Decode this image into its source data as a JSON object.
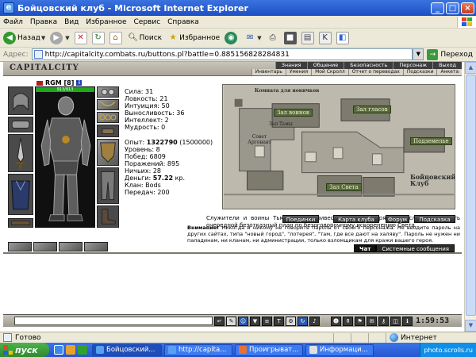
{
  "window": {
    "title": "Бойцовский клуб - Microsoft Internet Explorer",
    "buttons": [
      "_",
      "□",
      "×"
    ]
  },
  "menu": [
    "Файл",
    "Правка",
    "Вид",
    "Избранное",
    "Сервис",
    "Справка"
  ],
  "toolbar": {
    "back": "Назад",
    "search": "Поиск",
    "favorites": "Избранное"
  },
  "address": {
    "label": "Адрес:",
    "url": "http://capitalcity.combats.ru/buttons.pl?battle=0.885156828284831",
    "go": "Переход"
  },
  "site": {
    "logo": "CAPITALCITY",
    "nav_top": [
      "Знания",
      "Общение",
      "Безопасность",
      "Персонаж",
      "Выход"
    ],
    "nav_sub": [
      "Инвентарь",
      "Умения",
      "Мой Скролл",
      "Отчет о переводах",
      "Подсказки",
      "Анкета"
    ]
  },
  "character": {
    "name": "RGM",
    "level": "[8]",
    "hp": "913/913",
    "stats": [
      "Сила: 31",
      "Ловкость: 21",
      "Интуиция: 50",
      "Выносливость: 36",
      "Интеллект: 2",
      "Мудрость: 0"
    ],
    "experience_label": "Опыт:",
    "experience_value": "1322790",
    "experience_next": "(1500000)",
    "details": [
      "Уровень: 8",
      "Побед: 6809",
      "Поражений: 895",
      "Ничьих: 28"
    ],
    "money_label": "Деньги:",
    "money_value": "57.22",
    "money_unit": "кр.",
    "clan": "Клан: Bods",
    "transfers": "Передач: 200"
  },
  "map": {
    "labels": {
      "room1": "Комната для новичков",
      "room2": "Зал воинов",
      "room3": "Зал Тьмы",
      "room4": "Подземелье",
      "room5": "Совет Аргонавт",
      "room6": "Зал Света",
      "room7": "Зал гласов",
      "room8": "Бойцовский Клуб"
    },
    "description": "Служители и воины Тьмы могут привести здесь в порядок мысли и составить очередной безотказный план по безоговорочному искоренению Света."
  },
  "site_buttons": [
    "Поединки",
    "Карта клуба",
    "Форум",
    "Подсказка"
  ],
  "warning": {
    "bold": "Внимание!",
    "text": "Никогда и никому не говорите пароль от своего персонажа. Не вводите пароль на других сайтах, типа \"новый город\", \"лотерея\", \"там, где все дают на халяву\". Пароль не нужен ни паладинам, ни кланам, ни администрации, только взломщикам для кражи вашего героя."
  },
  "chat": {
    "tabs": [
      "Чат",
      "Системные сообщения"
    ]
  },
  "bottom_clock": "1:59:53",
  "status": {
    "left": "Готово",
    "zone": "Интернет"
  },
  "taskbar": {
    "start": "пуск",
    "tasks": [
      "Бойцовский...",
      "http://capita...",
      "Проигрыват...",
      "Информаци..."
    ],
    "tray": "photo.scrolls.ru"
  },
  "colors": {
    "hp": "#1da81d",
    "xp_title": "#1c4fc4",
    "taskbar": "#2456d0"
  }
}
